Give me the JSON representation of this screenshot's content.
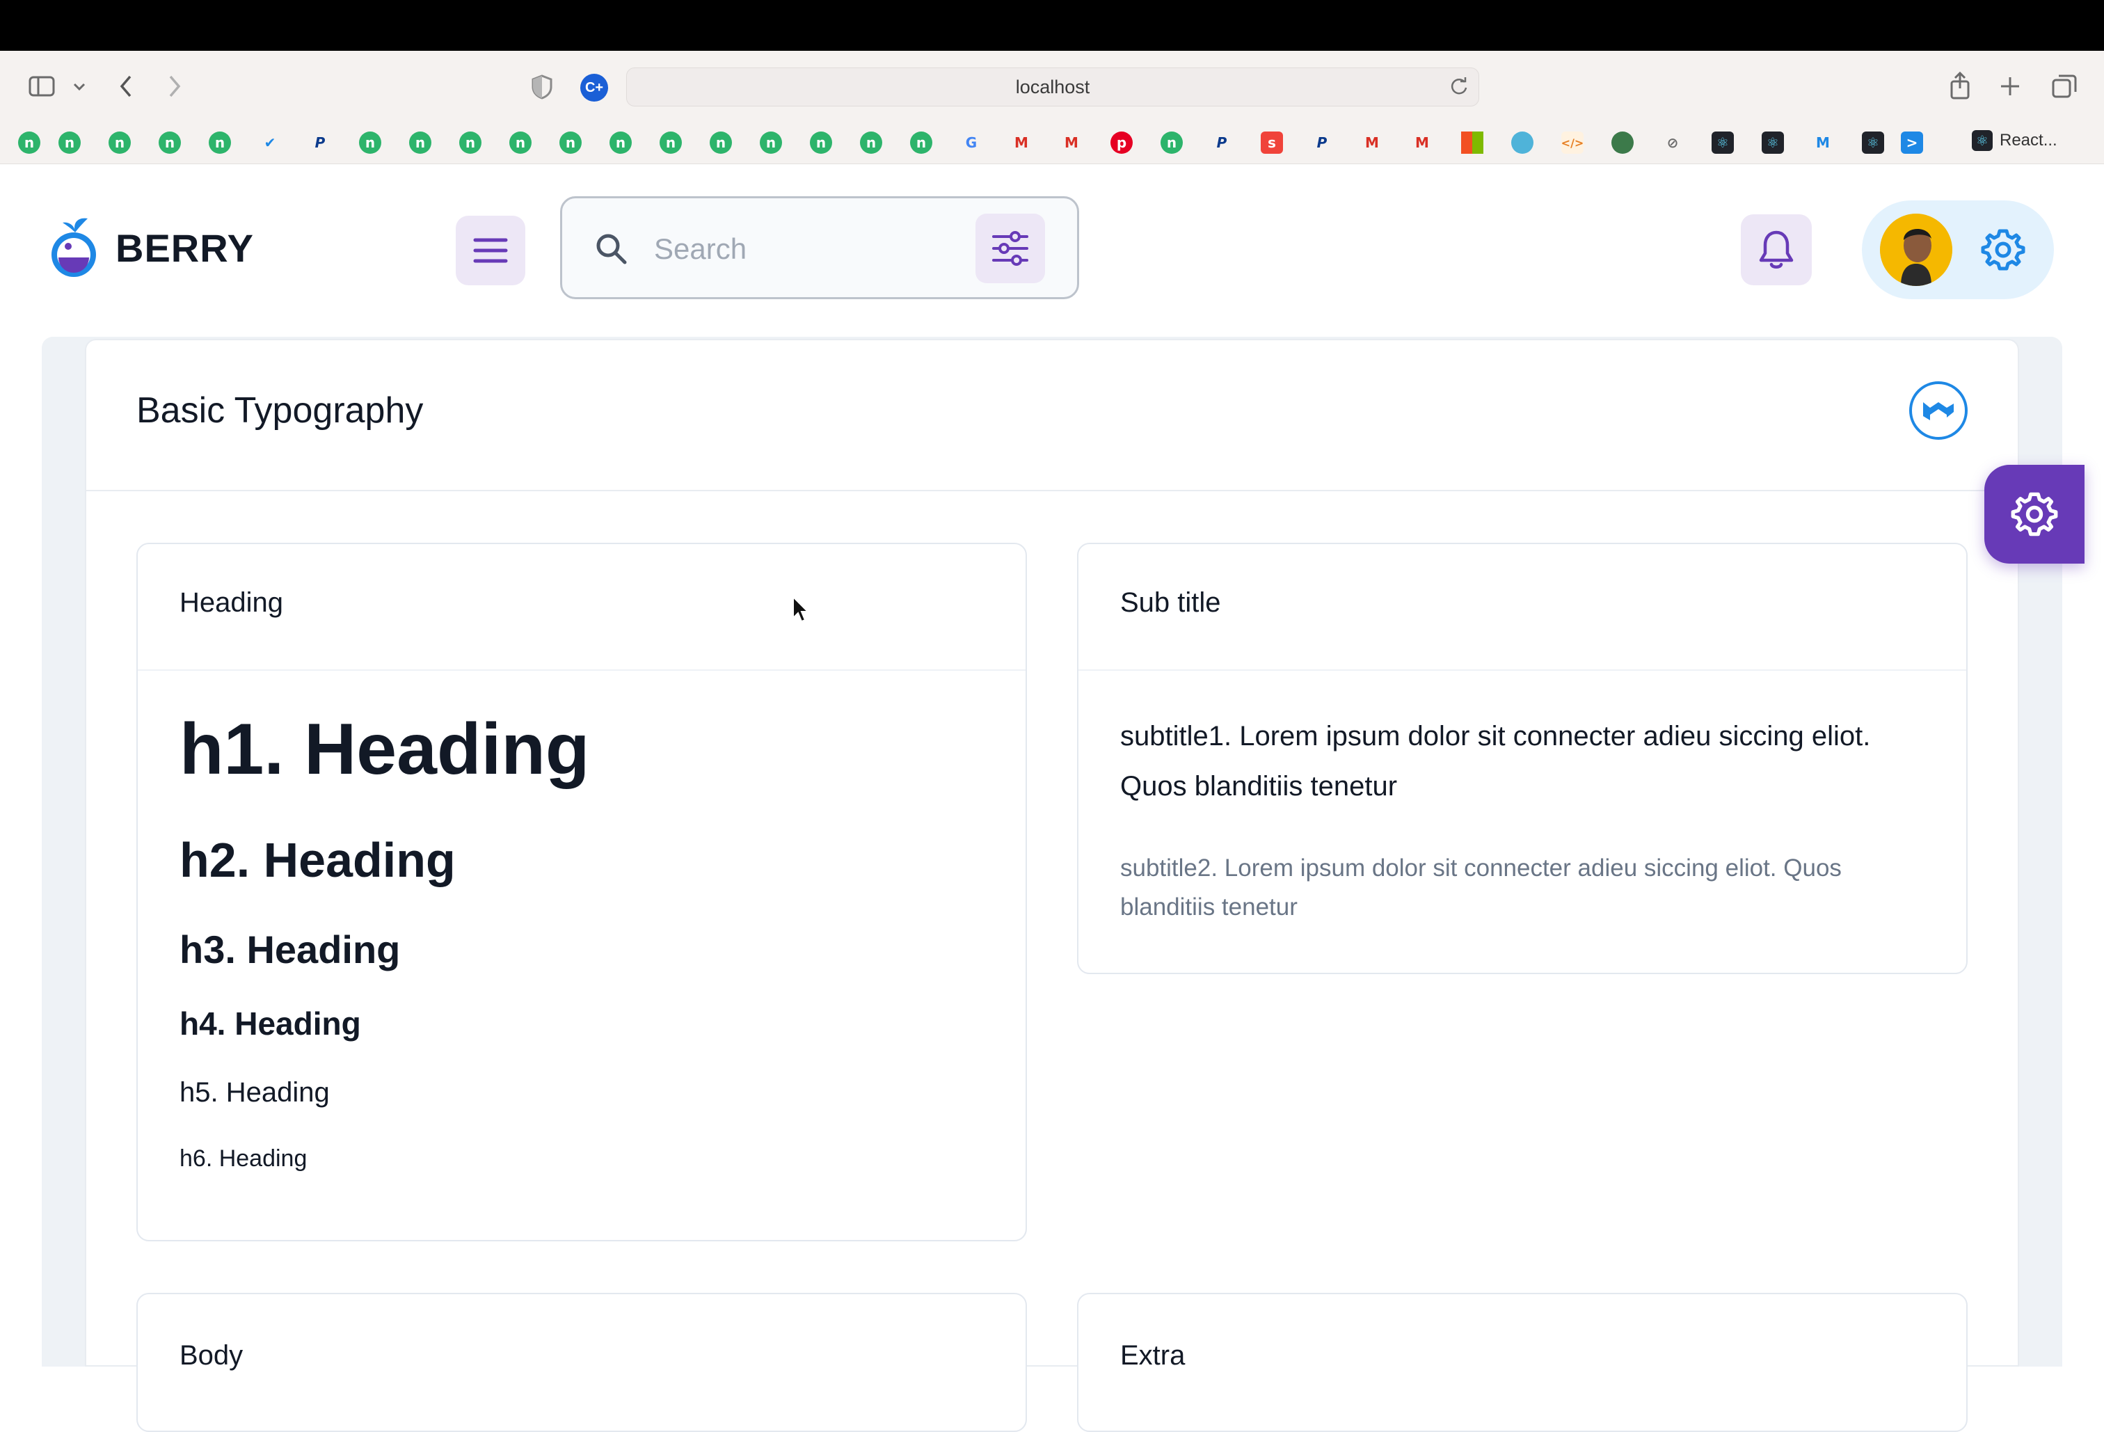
{
  "browser": {
    "url": "localhost",
    "bookmarks_last_label": "React..."
  },
  "header": {
    "brand": "BERRY",
    "search_placeholder": "Search"
  },
  "page": {
    "title": "Basic Typography"
  },
  "cards": {
    "heading": {
      "title": "Heading",
      "items": [
        "h1. Heading",
        "h2. Heading",
        "h3. Heading",
        "h4. Heading",
        "h5. Heading",
        "h6. Heading"
      ]
    },
    "subtitle": {
      "title": "Sub title",
      "subtitle1": "subtitle1. Lorem ipsum dolor sit connecter adieu siccing eliot. Quos blanditiis tenetur",
      "subtitle2": "subtitle2. Lorem ipsum dolor sit connecter adieu siccing eliot. Quos blanditiis tenetur"
    },
    "body": {
      "title": "Body"
    },
    "extra": {
      "title": "Extra"
    }
  },
  "colors": {
    "primary": "#673ab7",
    "secondary": "#1e88e5",
    "primary_light": "#ede7f6",
    "secondary_light": "#e3f2fd",
    "text_dark": "#121926",
    "text_muted": "#697586"
  },
  "icons": {
    "menu": "menu-icon",
    "search": "search-icon",
    "filter": "tune-icon",
    "notification": "bell-icon",
    "settings": "gear-icon",
    "mui": "material-ui-logo-icon"
  }
}
